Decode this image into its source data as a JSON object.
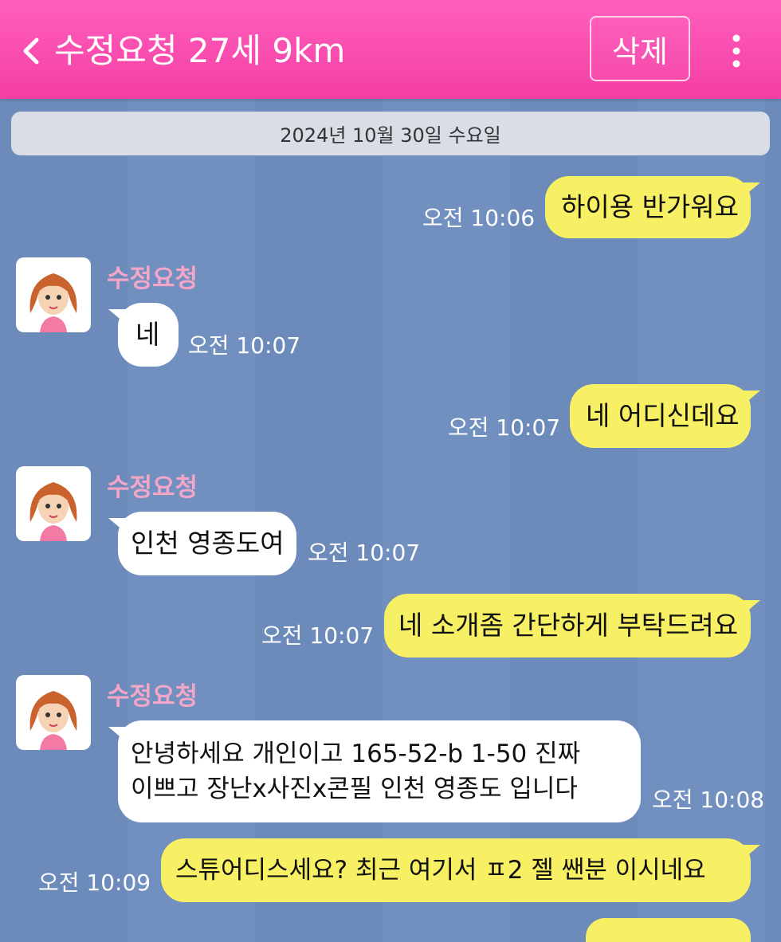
{
  "header": {
    "title": "수정요청 27세 9km",
    "delete_label": "삭제",
    "back_icon": "chevron-left-icon",
    "more_icon": "more-vertical-icon",
    "color": "#f43ea4"
  },
  "date_divider": "2024년 10월 30일 수요일",
  "contact": {
    "name": "수정요청",
    "avatar_icon": "girl-avatar-icon"
  },
  "messages": [
    {
      "from": "me",
      "text": "하이용 반가워요",
      "time": "오전 10:06"
    },
    {
      "from": "other",
      "text": "네",
      "time": "오전 10:07"
    },
    {
      "from": "me",
      "text": "네 어디신데요",
      "time": "오전 10:07"
    },
    {
      "from": "other",
      "text": "인천 영종도여",
      "time": "오전 10:07"
    },
    {
      "from": "me",
      "text": "네 소개좀 간단하게 부탁드려요",
      "time": "오전 10:07"
    },
    {
      "from": "other",
      "lines": [
        "안녕하세요 개인이고 165-52-b 1-50 진짜",
        "이쁘고 장난x사진x콘필 인천 영종도 입니다"
      ],
      "time": "오전 10:08"
    },
    {
      "from": "me",
      "text": "스튜어디스세요? 최근 여기서 ㅍ2 젤 쌘분 이시네요",
      "time": "오전 10:09"
    }
  ],
  "colors": {
    "my_bubble": "#f7ef64",
    "other_bubble": "#ffffff",
    "chat_bg": "#6c8bbb",
    "sender_name": "#f3a6c8"
  }
}
